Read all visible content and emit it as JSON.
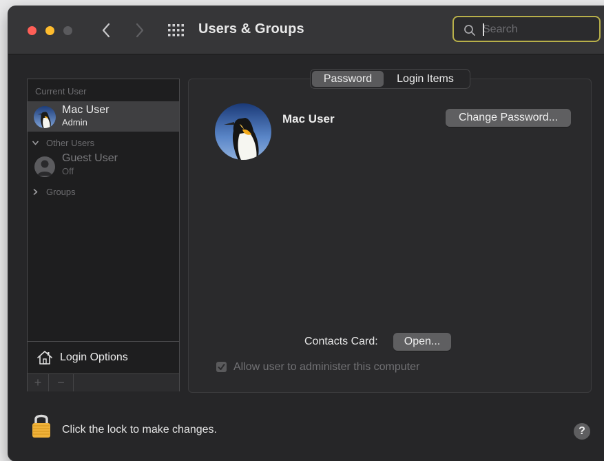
{
  "window": {
    "title": "Users & Groups",
    "search_placeholder": "Search"
  },
  "sidebar": {
    "current_user_label": "Current User",
    "current_user": {
      "name": "Mac User",
      "role": "Admin"
    },
    "other_users_label": "Other Users",
    "guest_user": {
      "name": "Guest User",
      "status": "Off"
    },
    "groups_label": "Groups",
    "login_options_label": "Login Options",
    "add_symbol": "+",
    "remove_symbol": "−"
  },
  "tabs": [
    {
      "label": "Password",
      "selected": true
    },
    {
      "label": "Login Items",
      "selected": false
    }
  ],
  "main": {
    "user_name": "Mac User",
    "change_password_label": "Change Password...",
    "contacts_card_label": "Contacts Card:",
    "open_label": "Open...",
    "allow_admin_label": "Allow user to administer this computer",
    "allow_admin_checked": true
  },
  "footer": {
    "lock_text": "Click the lock to make changes.",
    "help_symbol": "?"
  },
  "icons": {
    "back": "chevron-left-icon",
    "forward": "chevron-right-icon",
    "grid": "grid-icon",
    "search": "search-icon",
    "home": "house-icon",
    "lock": "lock-icon",
    "help": "help-icon"
  },
  "colors": {
    "close": "#ff5f57",
    "minimize": "#febc2e",
    "search_focus": "#b8b04a",
    "lock": "#f0b23a"
  }
}
